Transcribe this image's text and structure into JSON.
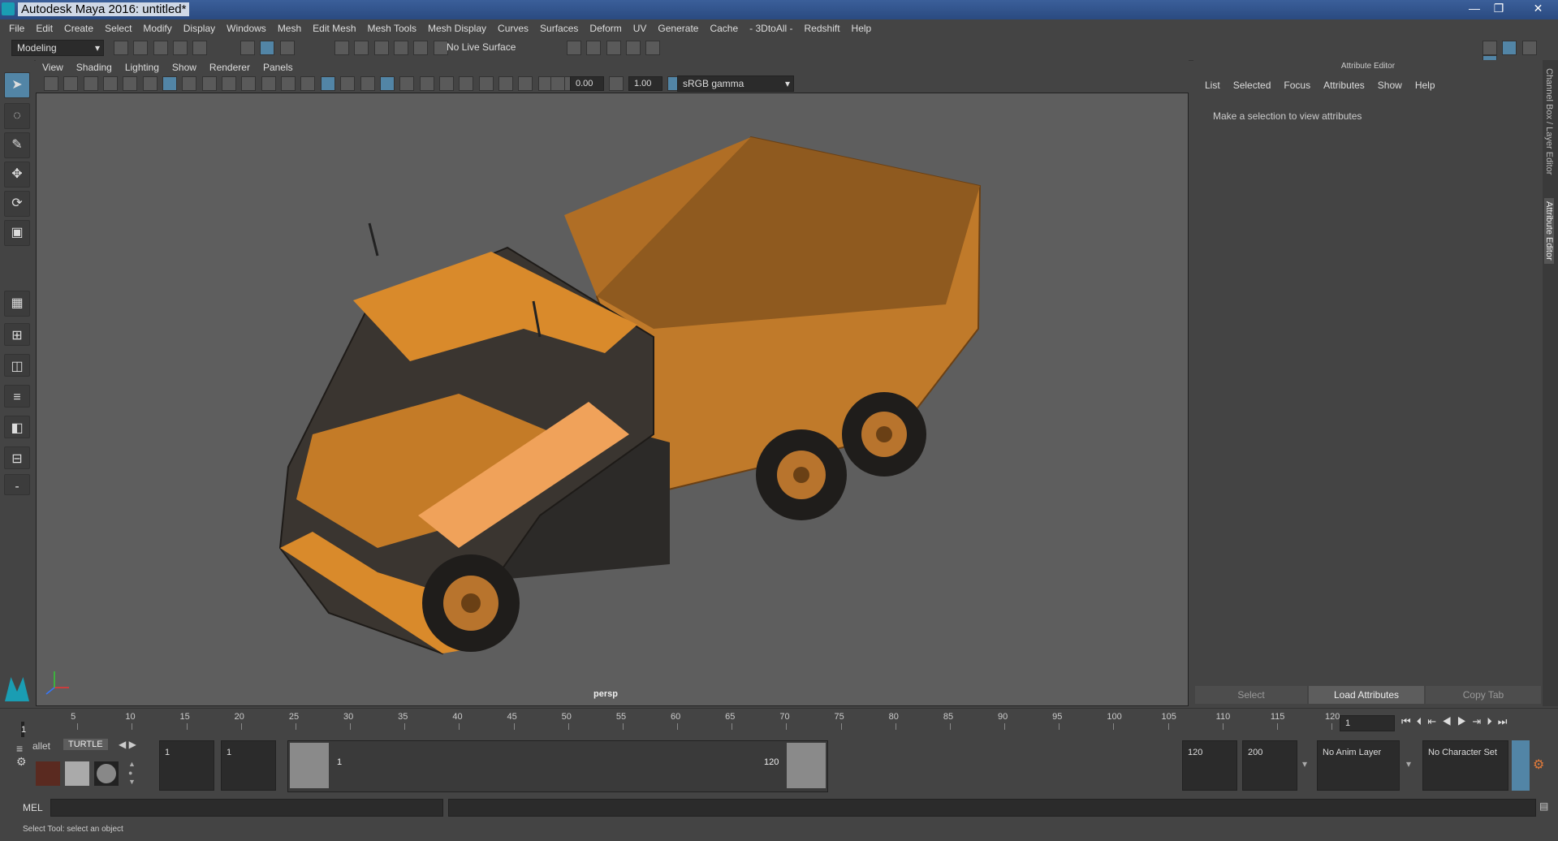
{
  "window": {
    "title": "Autodesk Maya 2016: untitled*",
    "min": "—",
    "max": "❐",
    "close": "✕"
  },
  "menus": [
    "File",
    "Edit",
    "Create",
    "Select",
    "Modify",
    "Display",
    "Windows",
    "Mesh",
    "Edit Mesh",
    "Mesh Tools",
    "Mesh Display",
    "Curves",
    "Surfaces",
    "Deform",
    "UV",
    "Generate",
    "Cache",
    "- 3DtoAll -",
    "Redshift",
    "Help"
  ],
  "status": {
    "mode": "Modeling",
    "live_surface": "No Live Surface"
  },
  "panel_menu": [
    "View",
    "Shading",
    "Lighting",
    "Show",
    "Renderer",
    "Panels"
  ],
  "viewport_toolbar": {
    "exposure": "0.00",
    "gamma": "1.00",
    "color_space": "sRGB gamma"
  },
  "viewport": {
    "camera_label": "persp"
  },
  "attribute_editor": {
    "header": "Attribute Editor",
    "menu": [
      "List",
      "Selected",
      "Focus",
      "Attributes",
      "Show",
      "Help"
    ],
    "message": "Make a selection to view attributes",
    "buttons": {
      "select": "Select",
      "load": "Load Attributes",
      "copy": "Copy Tab"
    },
    "side_tabs": [
      "Channel Box / Layer Editor",
      "Attribute Editor"
    ]
  },
  "timeline": {
    "ticks": [
      "5",
      "10",
      "15",
      "20",
      "25",
      "30",
      "35",
      "40",
      "45",
      "50",
      "55",
      "60",
      "65",
      "70",
      "75",
      "80",
      "85",
      "90",
      "95",
      "100",
      "105",
      "110",
      "115",
      "120"
    ],
    "start_marker": "1",
    "current_frame": "1"
  },
  "shelf": {
    "tab_partial": "allet",
    "tab_active": "TURTLE"
  },
  "range": {
    "start": "1",
    "playback_start": "1",
    "slider_start": "1",
    "slider_end": "120",
    "playback_end": "120",
    "end": "200",
    "anim_layer": "No Anim Layer",
    "character_set": "No Character Set"
  },
  "command_line": {
    "label": "MEL"
  },
  "help_line": {
    "text": "Select Tool: select an object"
  },
  "colors": {
    "accent": "#5285a6",
    "truck_orange": "#d98a2b",
    "viewport_bg": "#5e5e5e"
  }
}
